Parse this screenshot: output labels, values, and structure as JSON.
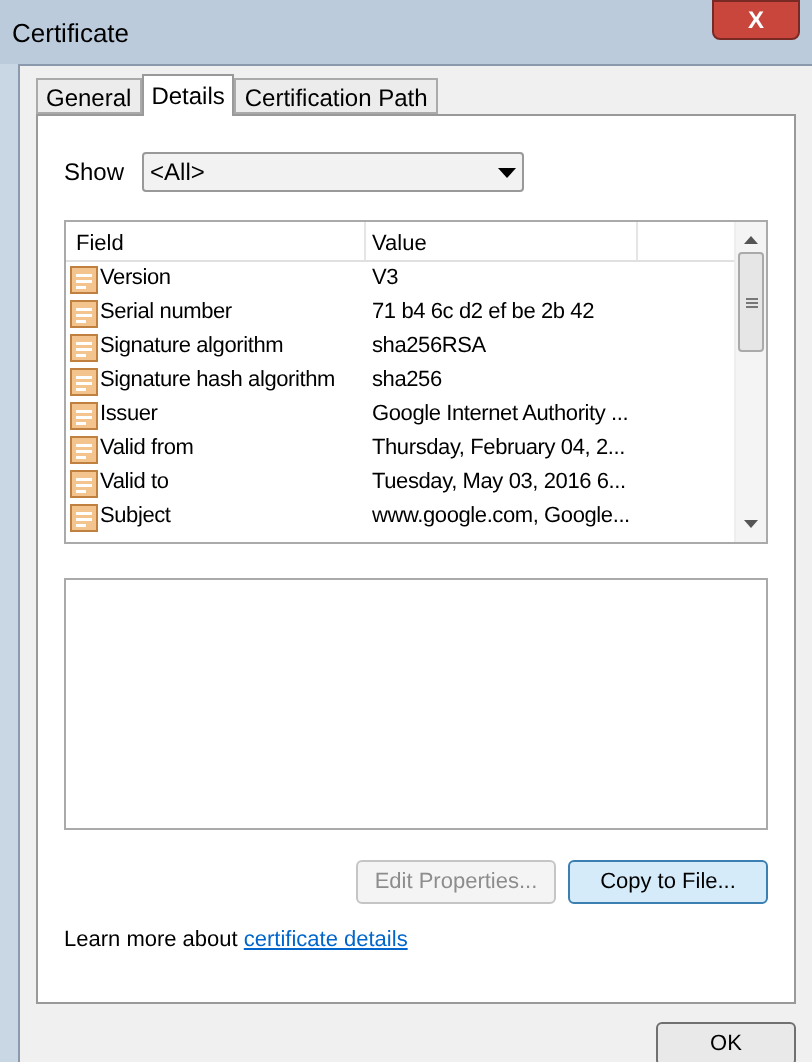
{
  "window": {
    "title": "Certificate",
    "close": "X"
  },
  "tabs": [
    {
      "label": "General",
      "selected": false
    },
    {
      "label": "Details",
      "selected": true
    },
    {
      "label": "Certification Path",
      "selected": false
    }
  ],
  "show": {
    "label": "Show",
    "value": "<All>"
  },
  "table": {
    "columns": [
      "Field",
      "Value"
    ],
    "rows": [
      {
        "field": "Version",
        "value": "V3"
      },
      {
        "field": "Serial number",
        "value": "71 b4 6c d2 ef be 2b 42"
      },
      {
        "field": "Signature algorithm",
        "value": "sha256RSA"
      },
      {
        "field": "Signature hash algorithm",
        "value": "sha256"
      },
      {
        "field": "Issuer",
        "value": "Google Internet Authority ..."
      },
      {
        "field": "Valid from",
        "value": "Thursday, February 04, 2..."
      },
      {
        "field": "Valid to",
        "value": "Tuesday, May 03, 2016 6..."
      },
      {
        "field": "Subject",
        "value": "www.google.com, Google..."
      }
    ]
  },
  "buttons": [
    {
      "label": "Edit Properties...",
      "disabled": true,
      "hovered": false
    },
    {
      "label": "Copy to File...",
      "disabled": false,
      "hovered": true
    }
  ],
  "learn_more": {
    "text": "Learn more about ",
    "link": "certificate details"
  },
  "ok": {
    "label": "OK"
  }
}
